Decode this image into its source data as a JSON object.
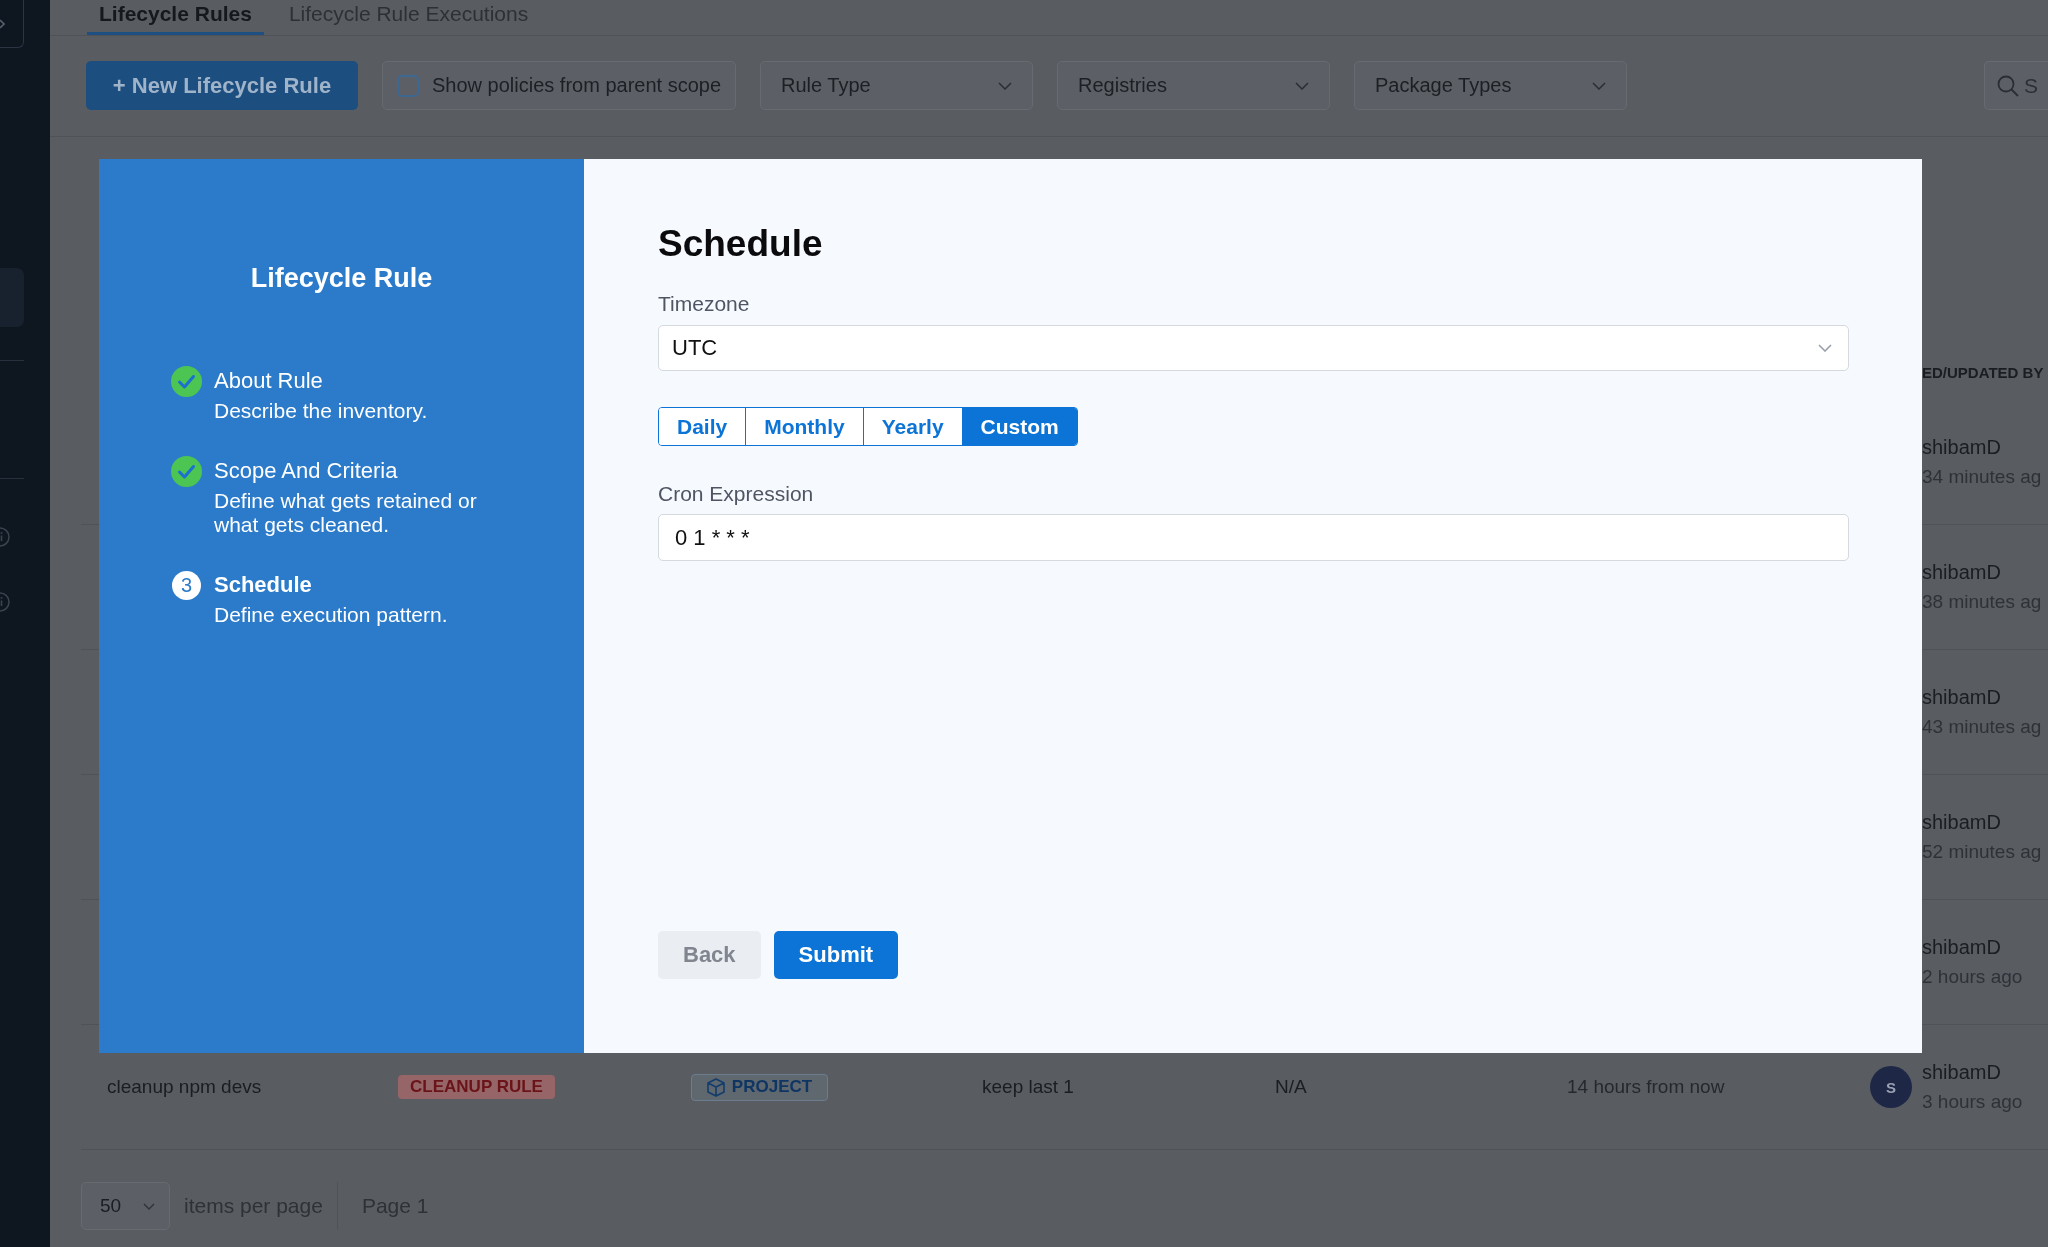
{
  "tabs": [
    {
      "label": "Lifecycle Rules",
      "selected": true
    },
    {
      "label": "Lifecycle Rule Executions",
      "selected": false
    }
  ],
  "toolbar": {
    "new_button": "+ New Lifecycle Rule",
    "parent_scope": {
      "label": "Show policies from parent scope",
      "checked": false
    },
    "filters": [
      "Rule Type",
      "Registries",
      "Package Types"
    ],
    "search": {
      "placeholder": "S"
    }
  },
  "table": {
    "header": {
      "column_7": "ED/UPDATED BY"
    },
    "rows": [
      {
        "column_7": {
          "user": "shibamD",
          "time": "34 minutes ag"
        }
      },
      {
        "column_7": {
          "user": "shibamD",
          "time": "38 minutes ag"
        }
      },
      {
        "column_7": {
          "user": "shibamD",
          "time": "43 minutes ag"
        }
      },
      {
        "column_7": {
          "user": "shibamD",
          "time": "52 minutes ag"
        }
      },
      {
        "column_7": {
          "user": "shibamD",
          "time": "2 hours ago"
        }
      },
      {
        "column_1": "cleanup npm devs",
        "column_2": "CLEANUP RULE",
        "column_3": "PROJECT",
        "column_4": "keep last 1",
        "column_5": "N/A",
        "column_6": "14 hours from now",
        "column_7": {
          "avatar": "S",
          "user": "shibamD",
          "time": "3 hours ago"
        }
      }
    ]
  },
  "pagination": {
    "page_size": "50",
    "label": "items per page",
    "page": "Page 1"
  },
  "dialog": {
    "sidebar": {
      "title": "Lifecycle Rule",
      "steps": [
        {
          "title": "About Rule",
          "description": "Describe the inventory.",
          "completed": true,
          "selected": false
        },
        {
          "title": "Scope And Criteria",
          "description": "Define what gets retained or what gets cleaned.",
          "completed": true,
          "selected": false
        },
        {
          "number": "3",
          "title": "Schedule",
          "description": "Define execution pattern.",
          "completed": false,
          "selected": true
        }
      ]
    },
    "title": "Schedule",
    "timezone": {
      "label": "Timezone",
      "value": "UTC"
    },
    "frequency": [
      {
        "label": "Daily",
        "selected": false
      },
      {
        "label": "Monthly",
        "selected": false
      },
      {
        "label": "Yearly",
        "selected": false
      },
      {
        "label": "Custom",
        "selected": true
      }
    ],
    "cron": {
      "label": "Cron Expression",
      "value": "0 1 * * *"
    },
    "buttons": [
      {
        "label": "Back",
        "kind": "secondary"
      },
      {
        "label": "Submit",
        "kind": "primary"
      }
    ]
  }
}
